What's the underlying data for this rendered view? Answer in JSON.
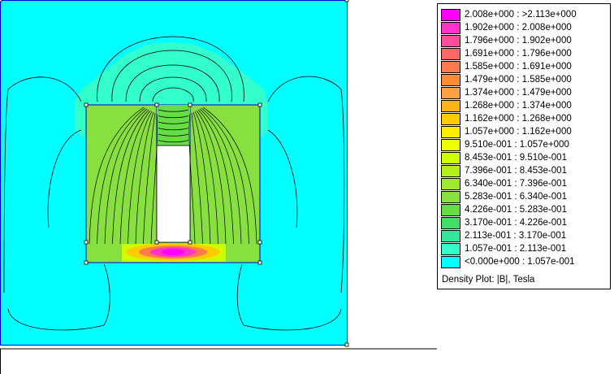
{
  "legend": {
    "title": "Density Plot: |B|, Tesla",
    "entries": [
      {
        "range": "2.008e+000 : >2.113e+000",
        "color": "#ff00ff"
      },
      {
        "range": "1.902e+000 : 2.008e+000",
        "color": "#ff33cc"
      },
      {
        "range": "1.796e+000 : 1.902e+000",
        "color": "#ff4d99"
      },
      {
        "range": "1.691e+000 : 1.796e+000",
        "color": "#ff6666"
      },
      {
        "range": "1.585e+000 : 1.691e+000",
        "color": "#ff7a4d"
      },
      {
        "range": "1.479e+000 : 1.585e+000",
        "color": "#ff8c33"
      },
      {
        "range": "1.374e+000 : 1.479e+000",
        "color": "#ffa040"
      },
      {
        "range": "1.268e+000 : 1.374e+000",
        "color": "#ffb31a"
      },
      {
        "range": "1.162e+000 : 1.268e+000",
        "color": "#ffcc00"
      },
      {
        "range": "1.057e+000 : 1.162e+000",
        "color": "#ffee00"
      },
      {
        "range": "9.510e-001 : 1.057e+000",
        "color": "#eeff00"
      },
      {
        "range": "8.453e-001 : 9.510e-001",
        "color": "#ccff00"
      },
      {
        "range": "7.396e-001 : 8.453e-001",
        "color": "#b3f019"
      },
      {
        "range": "6.340e-001 : 7.396e-001",
        "color": "#a0e830"
      },
      {
        "range": "5.283e-001 : 6.340e-001",
        "color": "#88e040"
      },
      {
        "range": "4.226e-001 : 5.283e-001",
        "color": "#66dd44"
      },
      {
        "range": "3.170e-001 : 4.226e-001",
        "color": "#44dd66"
      },
      {
        "range": "2.113e-001 : 3.170e-001",
        "color": "#33e699"
      },
      {
        "range": "1.057e-001 : 2.113e-001",
        "color": "#33ffcc"
      },
      {
        "range": "<0.000e+000 : 1.057e-001",
        "color": "#00ffff"
      }
    ]
  },
  "colors": {
    "background_field": "#00ffff",
    "aura_field": "#33ffcc",
    "core_field": "#88e040",
    "gap_field": "#ff00ff",
    "contour": "#000000"
  }
}
